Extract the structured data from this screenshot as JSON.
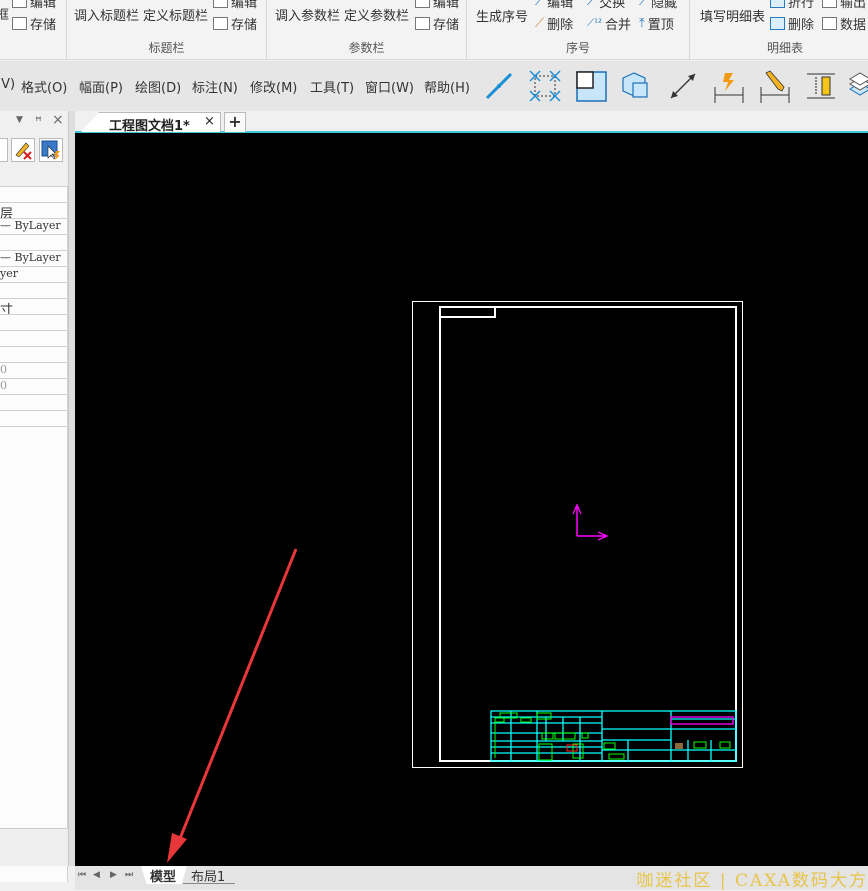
{
  "ribbon": {
    "groups": [
      {
        "name": "frame",
        "label": "",
        "items": [
          {
            "label": "框"
          },
          {
            "label": "编辑"
          },
          {
            "label": "存储"
          }
        ]
      },
      {
        "name": "title-block",
        "label": "标题栏",
        "items": [
          {
            "label": "调入标题栏"
          },
          {
            "label": "定义标题栏"
          },
          {
            "label": "编辑"
          },
          {
            "label": "存储"
          }
        ]
      },
      {
        "name": "parameter-bar",
        "label": "参数栏",
        "items": [
          {
            "label": "调入参数栏"
          },
          {
            "label": "定义参数栏"
          },
          {
            "label": "编辑"
          },
          {
            "label": "存储"
          }
        ]
      },
      {
        "name": "sequence-number",
        "label": "序号",
        "items": [
          {
            "label": "生成序号"
          },
          {
            "label": "编辑"
          },
          {
            "label": "删除"
          },
          {
            "label": "交换"
          },
          {
            "label": "合并"
          },
          {
            "label": "隐藏"
          },
          {
            "label": "置顶"
          }
        ]
      },
      {
        "name": "detail-list",
        "label": "明细表",
        "items": [
          {
            "label": "填写明细表"
          },
          {
            "label": "折行"
          },
          {
            "label": "删除"
          },
          {
            "label": "输出"
          },
          {
            "label": "数据"
          }
        ]
      }
    ]
  },
  "menubar": {
    "items": [
      {
        "label": "(V)"
      },
      {
        "label": "格式(O)"
      },
      {
        "label": "幅面(P)"
      },
      {
        "label": "绘图(D)"
      },
      {
        "label": "标注(N)"
      },
      {
        "label": "修改(M)"
      },
      {
        "label": "工具(T)"
      },
      {
        "label": "窗口(W)"
      },
      {
        "label": "帮助(H)"
      }
    ],
    "tools": [
      "line-tool-icon",
      "center-mark-icon",
      "view-frame-icon",
      "3d-view-icon",
      "aligned-dimension-icon",
      "quick-dimension-icon",
      "edit-dimension-icon",
      "ruler-dimension-icon",
      "layer-stack-icon"
    ]
  },
  "left_panel": {
    "header_icons": [
      "dropdown",
      "pin",
      "close"
    ],
    "rows": [
      {
        "text": ""
      },
      {
        "text": ""
      },
      {
        "text": "层"
      },
      {
        "text": "— ByLayer"
      },
      {
        "text": ""
      },
      {
        "text": "— ByLayer"
      },
      {
        "text": "yer"
      },
      {
        "text": ""
      },
      {
        "text": "寸"
      },
      {
        "text": ""
      },
      {
        "text": ""
      },
      {
        "text": ""
      },
      {
        "text": "0"
      },
      {
        "text": "0"
      },
      {
        "text": ""
      },
      {
        "text": ""
      }
    ]
  },
  "tabs": {
    "document": "工程图文档1*",
    "close": "×",
    "add": "+"
  },
  "bottom": {
    "nav": [
      "⏮",
      "◀",
      "▶",
      "⏭"
    ],
    "layout_tabs": [
      {
        "label": "模型",
        "active": true
      },
      {
        "label": "布局1",
        "active": false
      }
    ],
    "watermark": "咖迷社区 | CAXA数码大方"
  },
  "colors": {
    "accent": "#3cc8d4",
    "canvas": "#000000",
    "frame": "#ffffff",
    "title_block": "#00ffff",
    "title_block_fields": "#00ff00",
    "title_block_highlight": "#ff00ff",
    "ucs": "#ff00ff",
    "arrow_annotation": "#e8373a",
    "watermark": "#e8c44a"
  }
}
